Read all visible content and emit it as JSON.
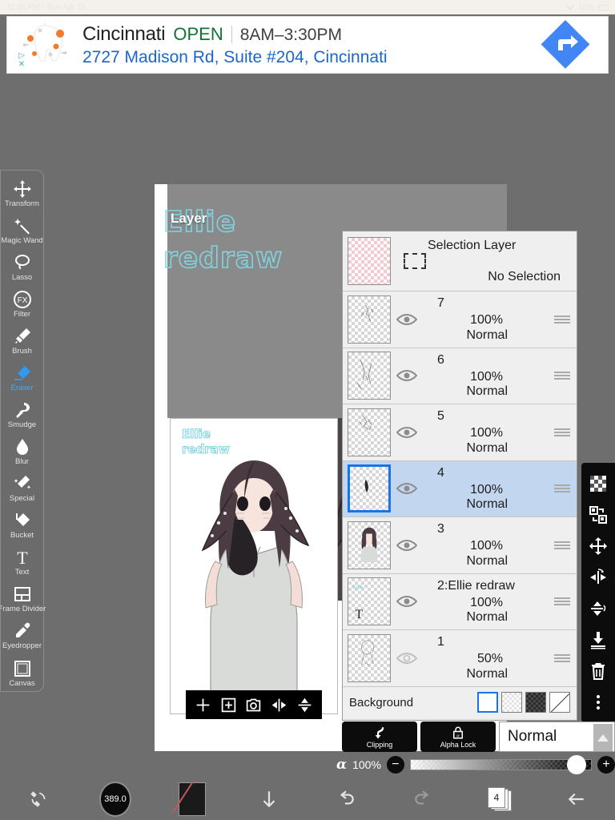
{
  "statusbar": {
    "time": "11:46 PM",
    "date": "Sun Apr 11",
    "wifi_icon": "wifi-icon",
    "battery": "16%"
  },
  "ad": {
    "logo_icon": "dental-tooth-logo",
    "adchoices_icon": "adchoices-triangle-icon",
    "close_icon": "close-x-icon",
    "business_name": "Cincinnati",
    "open_status": "OPEN",
    "hours": "8AM–3:30PM",
    "address": "2727 Madison Rd, Suite #204, Cincinnati",
    "directions_icon": "directions-arrow-icon",
    "accent_blue": "#1a66d0",
    "open_green": "#137333"
  },
  "canvas": {
    "layer_badge": "Layer",
    "artwork_title_line1": "Ellie",
    "artwork_title_line2": "redraw",
    "preview_title_line1": "Ellie",
    "preview_title_line2": "redraw",
    "preview_toolbar": [
      {
        "name": "add-layer-button",
        "icon": "plus-icon"
      },
      {
        "name": "duplicate-layer-button",
        "icon": "add-frame-icon"
      },
      {
        "name": "camera-import-button",
        "icon": "camera-icon"
      },
      {
        "name": "flip-horizontal-button",
        "icon": "flip-horizontal-icon"
      },
      {
        "name": "flip-vertical-button",
        "icon": "flip-vertical-icon"
      }
    ]
  },
  "tools": [
    {
      "label": "Transform",
      "icon": "transform-icon",
      "active": false
    },
    {
      "label": "Magic Wand",
      "icon": "magic-wand-icon",
      "active": false
    },
    {
      "label": "Lasso",
      "icon": "lasso-icon",
      "active": false
    },
    {
      "label": "Filter",
      "icon": "filter-fx-icon",
      "active": false
    },
    {
      "label": "Brush",
      "icon": "brush-icon",
      "active": false
    },
    {
      "label": "Eraser",
      "icon": "eraser-icon",
      "active": true
    },
    {
      "label": "Smudge",
      "icon": "smudge-icon",
      "active": false
    },
    {
      "label": "Blur",
      "icon": "blur-droplet-icon",
      "active": false
    },
    {
      "label": "Special",
      "icon": "special-sparkle-icon",
      "active": false
    },
    {
      "label": "Bucket",
      "icon": "bucket-icon",
      "active": false
    },
    {
      "label": "Text",
      "icon": "text-t-icon",
      "active": false
    },
    {
      "label": "Frame Divider",
      "icon": "frame-divider-icon",
      "active": false
    },
    {
      "label": "Eyedropper",
      "icon": "eyedropper-icon",
      "active": false
    },
    {
      "label": "Canvas",
      "icon": "canvas-square-icon",
      "active": false
    }
  ],
  "right_tools": [
    {
      "name": "transparency-checker-button",
      "icon": "checkerboard-icon"
    },
    {
      "name": "rotate-swap-button",
      "icon": "swap-rotate-icon"
    },
    {
      "name": "move-button",
      "icon": "move-arrows-icon"
    },
    {
      "name": "flip-horizontal-button",
      "icon": "flip-horizontal-icon"
    },
    {
      "name": "flip-vertical-button",
      "icon": "flip-vertical-icon"
    },
    {
      "name": "merge-down-button",
      "icon": "merge-down-icon"
    },
    {
      "name": "delete-layer-button",
      "icon": "trash-icon"
    },
    {
      "name": "more-options-button",
      "icon": "more-vertical-icon"
    }
  ],
  "layers_panel": {
    "selection_layer": {
      "title": "Selection Layer",
      "status": "No Selection",
      "marquee_icon": "dashed-rectangle-icon"
    },
    "layers": [
      {
        "name": "7",
        "opacity": "100%",
        "mode": "Normal",
        "visible": true,
        "selected": false
      },
      {
        "name": "6",
        "opacity": "100%",
        "mode": "Normal",
        "visible": true,
        "selected": false
      },
      {
        "name": "5",
        "opacity": "100%",
        "mode": "Normal",
        "visible": true,
        "selected": false
      },
      {
        "name": "4",
        "opacity": "100%",
        "mode": "Normal",
        "visible": true,
        "selected": true
      },
      {
        "name": "3",
        "opacity": "100%",
        "mode": "Normal",
        "visible": true,
        "selected": false
      },
      {
        "name": "2:Ellie redraw",
        "opacity": "100%",
        "mode": "Normal",
        "visible": true,
        "selected": false
      },
      {
        "name": "1",
        "opacity": "50%",
        "mode": "Normal",
        "visible": false,
        "selected": false
      }
    ],
    "background": {
      "label": "Background",
      "swatches": [
        {
          "name": "background-white-swatch",
          "kind": "white",
          "selected": true
        },
        {
          "name": "background-light-checker-swatch",
          "kind": "chk-light",
          "selected": false
        },
        {
          "name": "background-dark-checker-swatch",
          "kind": "chk-dark",
          "selected": false
        },
        {
          "name": "background-none-swatch",
          "kind": "diag",
          "selected": false
        }
      ]
    }
  },
  "layer_controls": {
    "clipping_label": "Clipping",
    "clipping_icon": "clipping-arrow-icon",
    "alpha_lock_label": "Alpha Lock",
    "alpha_lock_icon": "alpha-lock-icon",
    "blend_mode": "Normal",
    "blend_dropdown_icon": "chevron-up-icon",
    "alpha_symbol": "α",
    "alpha_value": "100%",
    "minus_label": "−",
    "plus_label": "+"
  },
  "bottom_nav": [
    {
      "name": "flip-canvas-button",
      "icon": "flip-canvas-icon",
      "label": ""
    },
    {
      "name": "brush-size-button",
      "icon": "brush-size-icon",
      "label": "389.0"
    },
    {
      "name": "color-swatch-button",
      "icon": "color-chip-icon",
      "label": ""
    },
    {
      "name": "download-button",
      "icon": "down-arrow-icon",
      "label": ""
    },
    {
      "name": "undo-button",
      "icon": "undo-icon",
      "label": ""
    },
    {
      "name": "redo-button",
      "icon": "redo-icon",
      "label": ""
    },
    {
      "name": "pages-button",
      "icon": "pages-stack-icon",
      "label": "4"
    },
    {
      "name": "back-button",
      "icon": "back-arrow-icon",
      "label": ""
    }
  ]
}
